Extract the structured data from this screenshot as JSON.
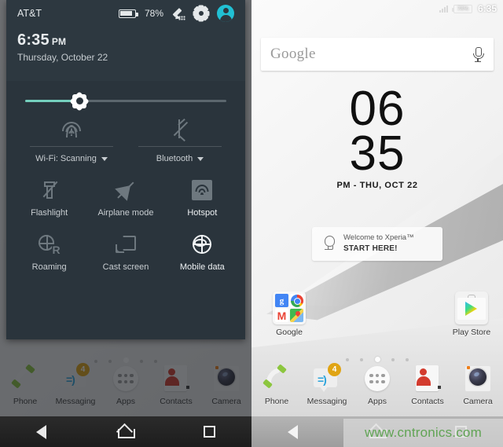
{
  "shade": {
    "carrier": "AT&T",
    "battery_percent": "78%",
    "icons": {
      "battery": "battery-icon",
      "edit": "edit-pencil-icon",
      "settings": "gear-icon",
      "user": "user-avatar-icon"
    },
    "time": "6:35",
    "ampm": "PM",
    "date": "Thursday, October 22",
    "brightness": {
      "label": "brightness-slider",
      "value_percent": 27
    },
    "top_tiles": [
      {
        "label": "Wi-Fi: Scanning",
        "icon": "wifi-alert-icon",
        "active": false,
        "has_caret": true
      },
      {
        "label": "Bluetooth",
        "icon": "bluetooth-off-icon",
        "active": false,
        "has_caret": true
      }
    ],
    "tiles": [
      {
        "label": "Flashlight",
        "icon": "flashlight-off-icon",
        "active": false
      },
      {
        "label": "Airplane mode",
        "icon": "airplane-off-icon",
        "active": false
      },
      {
        "label": "Hotspot",
        "icon": "hotspot-icon",
        "active": true
      },
      {
        "label": "Roaming",
        "icon": "roaming-globe-icon",
        "active": false
      },
      {
        "label": "Cast screen",
        "icon": "cast-screen-icon",
        "active": false
      },
      {
        "label": "Mobile data",
        "icon": "mobile-data-globe-icon",
        "active": true
      }
    ]
  },
  "home": {
    "status": {
      "battery_percent": "78%",
      "time": "6:35",
      "signal_icon": "signal-bars-icon",
      "battery_icon": "battery-icon"
    },
    "search": {
      "text": "Google",
      "placeholder": "Google",
      "mic_icon": "microphone-icon"
    },
    "clock": {
      "hours": "06",
      "minutes": "35",
      "subtitle": "PM - THU, OCT 22"
    },
    "welcome": {
      "line1": "Welcome to Xperia™",
      "line2": "START HERE!",
      "icon": "lightbulb-icon"
    },
    "icons": [
      {
        "label": "Google",
        "icon": "google-folder-icon"
      },
      {
        "label": "Play Store",
        "icon": "play-store-icon"
      }
    ],
    "folder_apps": [
      "google-search-icon",
      "chrome-icon",
      "gmail-icon",
      "maps-icon"
    ],
    "folder_letter": "g",
    "gmail_letter": "M",
    "page_dots": {
      "count": 5,
      "active_index": 2
    },
    "dock": [
      {
        "label": "Phone",
        "icon": "phone-handset-icon",
        "badge": ""
      },
      {
        "label": "Messaging",
        "icon": "messaging-bubble-icon",
        "badge": "4"
      },
      {
        "label": "Apps",
        "icon": "app-drawer-icon",
        "badge": ""
      },
      {
        "label": "Contacts",
        "icon": "contacts-person-icon",
        "badge": ""
      },
      {
        "label": "Camera",
        "icon": "camera-lens-icon",
        "badge": ""
      }
    ],
    "messaging_face": "=)"
  },
  "navbar": {
    "back": "back-triangle-icon",
    "home": "home-pentagon-icon",
    "recents": "recents-square-icon"
  },
  "watermark": {
    "text": "www.cntronics.com"
  },
  "colors": {
    "shade_bg": "#2d3840",
    "shade_body": "#2a343c",
    "accent_teal": "#74cfbd",
    "avatar_cyan": "#21c0d4",
    "badge_amber": "#e0a414",
    "watermark_green": "#61a455"
  }
}
